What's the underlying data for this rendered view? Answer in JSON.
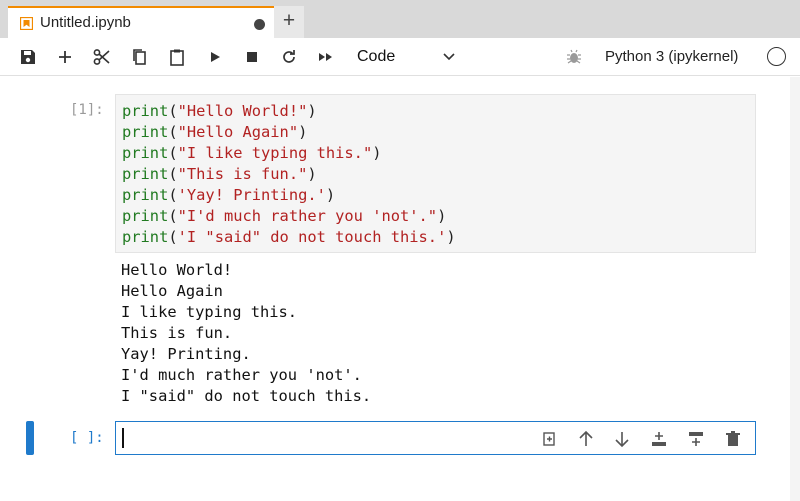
{
  "tab": {
    "title": "Untitled.ipynb",
    "icon": "notebook-icon",
    "accent": "#f28a00",
    "new_tab_label": "+"
  },
  "toolbar": {
    "icons": [
      "save-icon",
      "add-cell-icon",
      "cut-icon",
      "copy-icon",
      "paste-icon",
      "run-icon",
      "stop-icon",
      "restart-icon",
      "run-all-icon"
    ],
    "cell_type": "Code",
    "kernel_name": "Python 3 (ipykernel)"
  },
  "cells": {
    "executed": {
      "prompt": "[1]:",
      "code": [
        {
          "fn": "print",
          "arg": "\"Hello World!\""
        },
        {
          "fn": "print",
          "arg": "\"Hello Again\""
        },
        {
          "fn": "print",
          "arg": "\"I like typing this.\""
        },
        {
          "fn": "print",
          "arg": "\"This is fun.\""
        },
        {
          "fn": "print",
          "arg": "'Yay! Printing.'"
        },
        {
          "fn": "print",
          "arg": "\"I'd much rather you 'not'.\""
        },
        {
          "fn": "print",
          "arg": "'I \"said\" do not touch this.'"
        }
      ],
      "output": [
        "Hello World!",
        "Hello Again",
        "I like typing this.",
        "This is fun.",
        "Yay! Printing.",
        "I'd much rather you 'not'.",
        "I \"said\" do not touch this."
      ]
    },
    "active": {
      "prompt": "[ ]:",
      "tools": [
        "duplicate-cell-icon",
        "move-up-icon",
        "move-down-icon",
        "insert-above-icon",
        "insert-below-icon",
        "delete-cell-icon"
      ]
    }
  },
  "colors": {
    "keyword": "#217a21",
    "string": "#b22222",
    "active": "#1f7acb"
  }
}
